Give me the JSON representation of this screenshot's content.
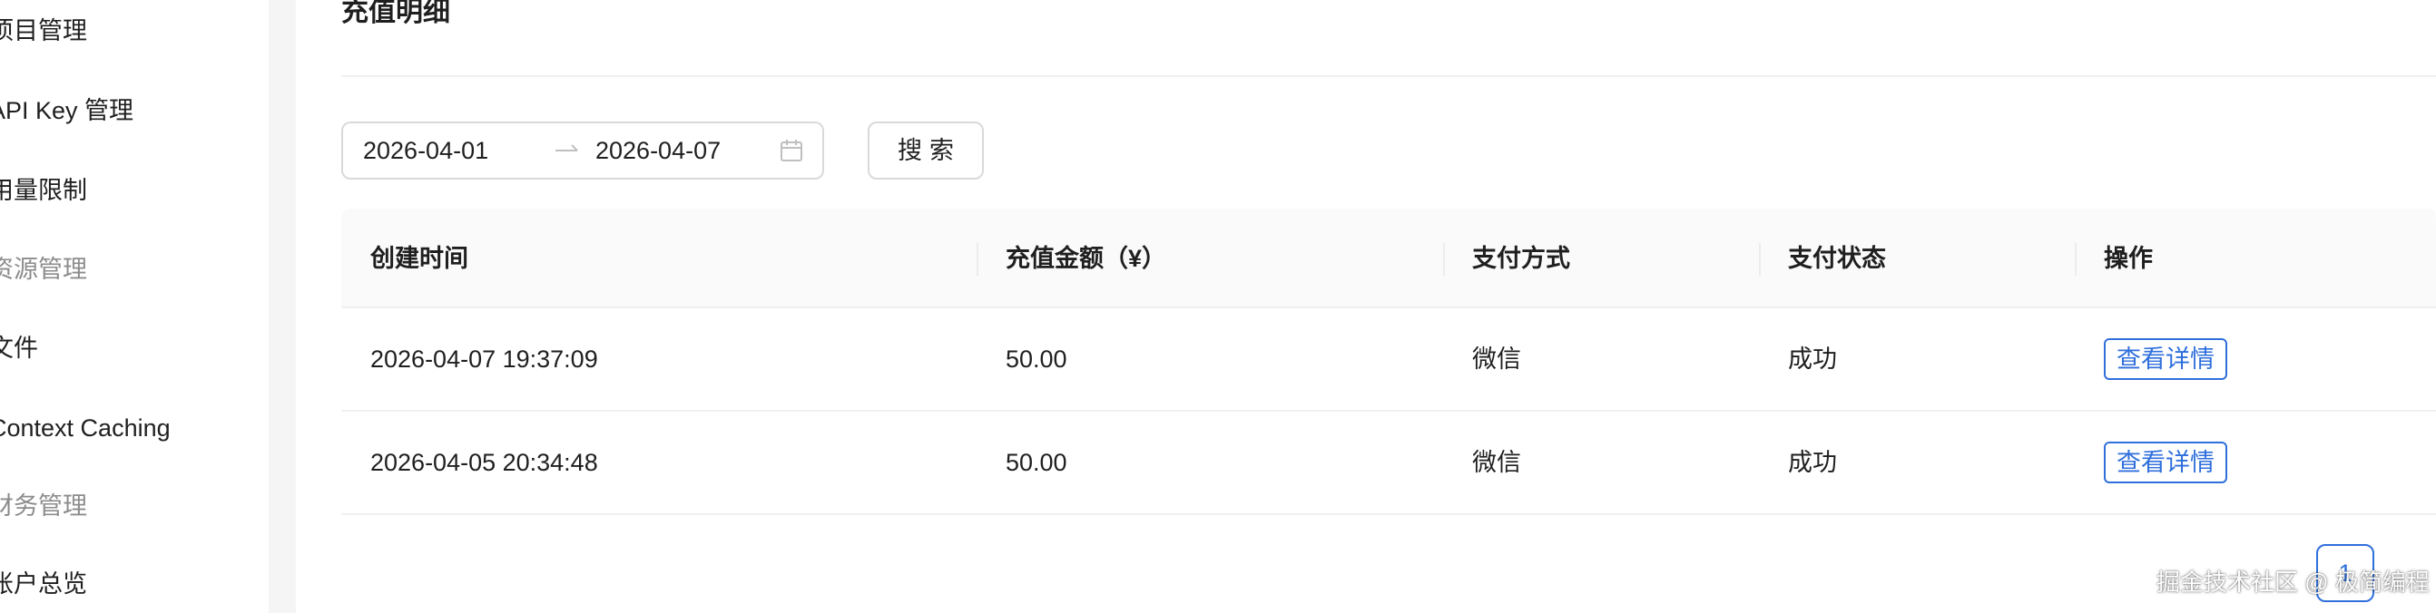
{
  "sidebar": {
    "items": [
      {
        "label": "项目管理",
        "kind": "normal"
      },
      {
        "label": "API Key 管理",
        "kind": "normal"
      },
      {
        "label": "用量限制",
        "kind": "normal"
      },
      {
        "label": "资源管理",
        "kind": "group"
      },
      {
        "label": "文件",
        "kind": "normal"
      },
      {
        "label": "Context Caching",
        "kind": "normal"
      },
      {
        "label": "财务管理",
        "kind": "group"
      },
      {
        "label": "账户总览",
        "kind": "normal"
      }
    ]
  },
  "main": {
    "title": "充值明细",
    "filter": {
      "start_date": "2026-04-01",
      "end_date": "2026-04-07",
      "search_label": "搜索"
    },
    "table": {
      "columns": [
        "创建时间",
        "充值金额（¥）",
        "支付方式",
        "支付状态",
        "操作"
      ],
      "rows": [
        {
          "created": "2026-04-07 19:37:09",
          "amount": "50.00",
          "method": "微信",
          "status": "成功",
          "action": "查看详情"
        },
        {
          "created": "2026-04-05 20:34:48",
          "amount": "50.00",
          "method": "微信",
          "status": "成功",
          "action": "查看详情"
        }
      ]
    },
    "pagination": {
      "current_page": "1"
    }
  },
  "watermark": "掘金技术社区 @ 极简编程",
  "colors": {
    "accent": "#2f6fdc",
    "header_bg": "#fafafa",
    "divider": "#f0f0f0",
    "sidebar_gutter": "#f5f5f6"
  }
}
